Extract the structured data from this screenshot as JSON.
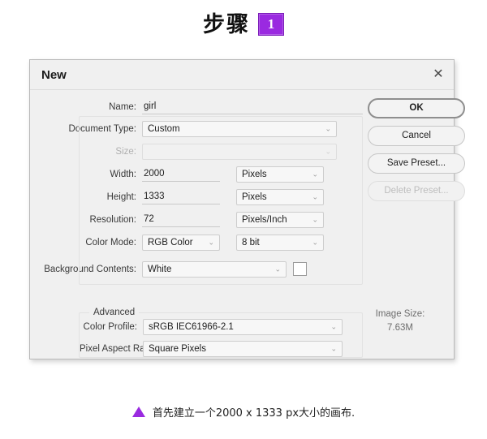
{
  "heading": {
    "step_word": "步骤",
    "step_number": "1",
    "badge_color": "#9a2ae0"
  },
  "dialog": {
    "title": "New",
    "close_icon": "✕",
    "fields": {
      "name_label": "Name:",
      "name_value": "girl",
      "doc_type_label": "Document Type:",
      "doc_type_value": "Custom",
      "size_label": "Size:",
      "size_value": "",
      "width_label": "Width:",
      "width_value": "2000",
      "width_unit": "Pixels",
      "height_label": "Height:",
      "height_value": "1333",
      "height_unit": "Pixels",
      "resolution_label": "Resolution:",
      "resolution_value": "72",
      "resolution_unit": "Pixels/Inch",
      "color_mode_label": "Color Mode:",
      "color_mode_value": "RGB Color",
      "bit_depth_value": "8 bit",
      "background_label": "Background Contents:",
      "background_value": "White",
      "background_swatch_color": "#ffffff"
    },
    "advanced": {
      "legend": "Advanced",
      "color_profile_label": "Color Profile:",
      "color_profile_value": "sRGB IEC61966-2.1",
      "pixel_aspect_label": "Pixel Aspect Ratio:",
      "pixel_aspect_value": "Square Pixels"
    },
    "buttons": {
      "ok": "OK",
      "cancel": "Cancel",
      "save_preset": "Save Preset...",
      "delete_preset": "Delete Preset..."
    },
    "image_size": {
      "label": "Image Size:",
      "value": "7.63M"
    },
    "chevron_icon": "⌄"
  },
  "caption": {
    "text": "首先建立一个2000 x 1333 px大小的画布."
  }
}
